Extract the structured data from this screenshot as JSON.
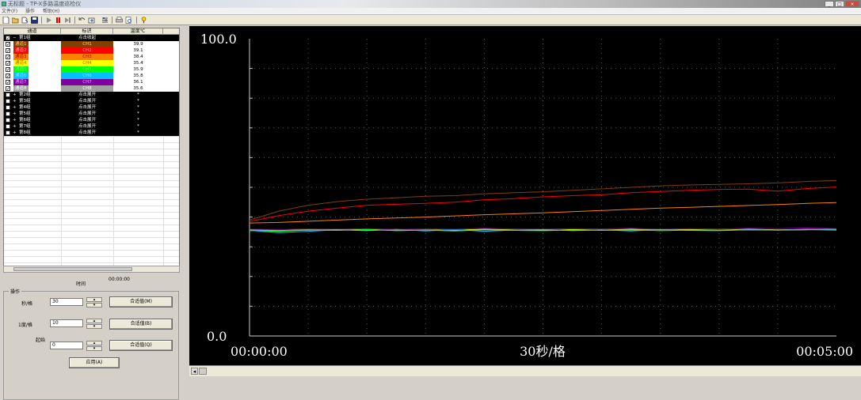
{
  "window": {
    "title": "无标题 - TP-X多路温度巡检仪"
  },
  "menu": [
    "文件(F)",
    "操作",
    "帮助(H)"
  ],
  "toolbar_icons": [
    "new-icon",
    "open-icon",
    "saveas-icon",
    "save-icon",
    "play-icon",
    "stop-icon",
    "pause-icon",
    "undo-icon",
    "export-icon",
    "settings-icon",
    "print-icon",
    "preview-icon",
    "help-icon"
  ],
  "table": {
    "headers": [
      "通道",
      "标识",
      "温度℃"
    ],
    "rows": [
      {
        "channel": "第1组",
        "label": "点击收起",
        "temp": "",
        "bg": "#000000",
        "fg": "#ffffff",
        "checked": true,
        "tree": "−"
      },
      {
        "channel": "通道1",
        "label": "CH1",
        "temp": "39.9",
        "bg": "#804000",
        "fg": "#ffd080",
        "checked": true,
        "tree": ""
      },
      {
        "channel": "通道2",
        "label": "CH2",
        "temp": "39.1",
        "bg": "#ff0000",
        "fg": "#ffb0b0",
        "checked": true,
        "tree": ""
      },
      {
        "channel": "通道3",
        "label": "CH3",
        "temp": "38.4",
        "bg": "#ff8000",
        "fg": "#a00000",
        "checked": true,
        "tree": ""
      },
      {
        "channel": "通道4",
        "label": "CH4",
        "temp": "35.4",
        "bg": "#ffff00",
        "fg": "#c06000",
        "checked": true,
        "tree": ""
      },
      {
        "channel": "通道5",
        "label": "CH5",
        "temp": "35.9",
        "bg": "#00ff00",
        "fg": "#80ff80",
        "checked": true,
        "tree": ""
      },
      {
        "channel": "通道6",
        "label": "CH6",
        "temp": "35.8",
        "bg": "#00c0ff",
        "fg": "#80e0ff",
        "checked": true,
        "tree": ""
      },
      {
        "channel": "通道7",
        "label": "CH7",
        "temp": "36.1",
        "bg": "#8000a0",
        "fg": "#e0a0ff",
        "checked": true,
        "tree": ""
      },
      {
        "channel": "通道8",
        "label": "CH8",
        "temp": "35.6",
        "bg": "#a0a0a0",
        "fg": "#ffffff",
        "checked": true,
        "tree": ""
      },
      {
        "channel": "第2组",
        "label": "点击展开",
        "temp": "*",
        "bg": "#000000",
        "fg": "#ffffff",
        "checked": false,
        "tree": "+"
      },
      {
        "channel": "第3组",
        "label": "点击展开",
        "temp": "*",
        "bg": "#000000",
        "fg": "#ffffff",
        "checked": false,
        "tree": "+"
      },
      {
        "channel": "第4组",
        "label": "点击展开",
        "temp": "*",
        "bg": "#000000",
        "fg": "#ffffff",
        "checked": false,
        "tree": "+"
      },
      {
        "channel": "第5组",
        "label": "点击展开",
        "temp": "*",
        "bg": "#000000",
        "fg": "#ffffff",
        "checked": false,
        "tree": "+"
      },
      {
        "channel": "第6组",
        "label": "点击展开",
        "temp": "*",
        "bg": "#000000",
        "fg": "#ffffff",
        "checked": false,
        "tree": "+"
      },
      {
        "channel": "第7组",
        "label": "点击展开",
        "temp": "*",
        "bg": "#000000",
        "fg": "#ffffff",
        "checked": false,
        "tree": "+"
      },
      {
        "channel": "第8组",
        "label": "点击展开",
        "temp": "*",
        "bg": "#000000",
        "fg": "#ffffff",
        "checked": false,
        "tree": "+"
      }
    ]
  },
  "time": {
    "label": "时间",
    "value": "00:00:00"
  },
  "operations": {
    "title": "操作",
    "sec_per_div": {
      "label": "秒/格",
      "value": "30",
      "button": "合适值(M)"
    },
    "deg_per_div": {
      "label": "1度/格",
      "value": "10",
      "button": "合适值(B)"
    },
    "start": {
      "label": "起始",
      "value": "0",
      "button": "合适值(Q)"
    },
    "apply_button": "应用(A)"
  },
  "chart_data": {
    "type": "line",
    "ymax_label": "100.0",
    "ymin_label": "0.0",
    "x_start_label": "00:00:00",
    "x_center_label": "30秒/格",
    "x_end_label": "00:05:00",
    "ylim": [
      0,
      100
    ],
    "xlim": [
      0,
      300
    ],
    "grid": true,
    "x": [
      0,
      15,
      30,
      45,
      60,
      75,
      90,
      105,
      120,
      135,
      150,
      165,
      180,
      195,
      210,
      225,
      240,
      255,
      270,
      285,
      300
    ],
    "series": [
      {
        "color": "#804000",
        "values": [
          39.0,
          42.0,
          44.0,
          45.2,
          46.0,
          46.5,
          47.0,
          47.2,
          47.8,
          48.2,
          48.5,
          49.0,
          49.5,
          50.0,
          50.5,
          50.8,
          51.0,
          51.2,
          51.5,
          52.0,
          52.3
        ]
      },
      {
        "color": "#ff0000",
        "values": [
          38.5,
          40.5,
          42.0,
          43.0,
          44.0,
          44.3,
          44.6,
          45.0,
          45.8,
          46.2,
          46.8,
          47.2,
          47.5,
          48.2,
          48.6,
          49.0,
          49.3,
          49.4,
          48.7,
          49.6,
          50.1
        ]
      },
      {
        "color": "#ff8000",
        "values": [
          38.0,
          38.2,
          38.6,
          39.0,
          39.4,
          39.7,
          40.0,
          40.4,
          40.8,
          41.1,
          41.4,
          41.8,
          42.2,
          42.6,
          43.0,
          43.3,
          43.6,
          43.9,
          44.2,
          44.6,
          44.9
        ]
      },
      {
        "color": "#ffff00",
        "values": [
          35.6,
          35.4,
          35.8,
          35.6,
          35.9,
          35.5,
          35.7,
          35.6,
          35.9,
          35.7,
          35.5,
          35.8,
          35.6,
          35.9,
          35.7,
          35.8,
          35.6,
          35.9,
          35.7,
          35.8,
          35.9
        ]
      },
      {
        "color": "#00ff00",
        "values": [
          35.4,
          35.2,
          35.6,
          35.5,
          35.8,
          35.4,
          35.6,
          35.3,
          35.7,
          35.5,
          35.4,
          35.6,
          35.5,
          35.7,
          35.4,
          35.6,
          35.5,
          35.7,
          35.6,
          35.7,
          35.8
        ]
      },
      {
        "color": "#00c0ff",
        "values": [
          35.5,
          34.8,
          35.2,
          35.7,
          35.4,
          35.9,
          35.3,
          35.8,
          35.2,
          35.6,
          35.9,
          35.4,
          35.7,
          35.3,
          35.8,
          35.5,
          35.4,
          35.8,
          35.6,
          35.9,
          35.7
        ]
      },
      {
        "color": "#8000a0",
        "values": [
          35.9,
          35.8,
          36.0,
          35.9,
          36.1,
          35.8,
          36.0,
          35.9,
          36.2,
          36.0,
          35.9,
          36.1,
          36.0,
          36.2,
          35.9,
          36.1,
          36.0,
          36.2,
          36.1,
          36.3,
          36.1
        ]
      },
      {
        "color": "#a0a0a0",
        "values": [
          35.7,
          35.5,
          35.6,
          35.8,
          35.5,
          35.7,
          35.6,
          35.4,
          35.7,
          35.6,
          35.8,
          35.5,
          35.7,
          35.6,
          35.8,
          35.6,
          35.5,
          35.7,
          35.6,
          35.8,
          35.6
        ]
      }
    ]
  }
}
